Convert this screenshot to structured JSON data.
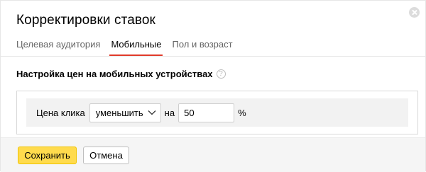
{
  "dialog": {
    "title": "Корректировки ставок",
    "close_icon": "close-icon"
  },
  "tabs": [
    {
      "label": "Целевая аудитория",
      "active": false
    },
    {
      "label": "Мобильные",
      "active": true
    },
    {
      "label": "Пол и возраст",
      "active": false
    }
  ],
  "section": {
    "title": "Настройка цен на мобильных устройствах",
    "help_icon": "question-icon"
  },
  "bid": {
    "label": "Цена клика",
    "direction": "уменьшить",
    "on_text": "на",
    "value": "50",
    "unit": "%"
  },
  "footer": {
    "save_label": "Сохранить",
    "cancel_label": "Отмена"
  },
  "colors": {
    "accent": "#ffdb4d",
    "tab_underline": "#e03a2a"
  }
}
